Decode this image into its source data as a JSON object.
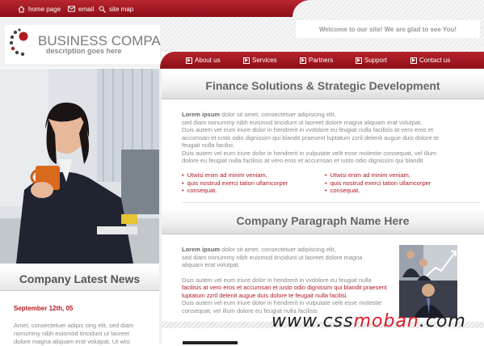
{
  "top_links": [
    {
      "label": "home page",
      "icon": "home-icon"
    },
    {
      "label": "email",
      "icon": "email-icon"
    },
    {
      "label": "site map",
      "icon": "sitemap-icon"
    }
  ],
  "logo": {
    "title": "BUSINESS COMPANY",
    "description": "description goes here"
  },
  "welcome": "Welcome to our site! We are glad to see You!",
  "nav": [
    "About us",
    "Services",
    "Partners",
    "Support",
    "Contact us"
  ],
  "section1": {
    "title": "Finance Solutions & Strategic Development",
    "lead_bold": "Lorem ipsum",
    "lead_rest": " dolor sit amet, consectetuer adipiscing elit,",
    "lines": [
      "sed diam nonummy nibh euismod tincidunt ut laoreet dolore magna aliquam erat volutpat.",
      "Duis autem vel eum iriure dolor in hendrerit in vvdolore eu feugiat nulla facilisis at vero eros et",
      "accumsan et iusto odio dignissim qui blandit praesent luptatum zzril delenit augue duis dolore te",
      "feugait nulla facilisi.",
      "Duis autem vel eum iriure dolor in hendrerit in vulputate velit esse molestie consequat, vel illum",
      "dolore eu feugiat nulla facilisis at vero eros et accumsan et iusto odio dignissim qui blandit"
    ],
    "bullets_left": [
      "Utwisi enim ad minim veniam,",
      "quis nostrud exerci tation ullamcorper",
      "consequat."
    ],
    "bullets_right": [
      "Utwisi enim ad minim veniam,",
      "quis nostrud exerci tation ullamcorper",
      "consequat."
    ]
  },
  "section2": {
    "title": "Company Paragraph Name Here",
    "lead_bold": "Lorem ipsum",
    "lead_rest": " dolor sit amet, consectetuer adipiscing elit,",
    "lines_a": [
      "sed diam nonummy nibh euismod tincidunt ut laoreet dolore magna",
      "aliquam erat volutpat."
    ],
    "line_b1": "Duis autem vel eum iriure dolor in hendrerit in vvdolore eu feugiat nulla",
    "red_lines": [
      "facilisis at vero eros et accumsan et iusto odio dignissim qui blandit praesent",
      "luptatum zzril delenit augue duis dolore te feugait nulla facilisi."
    ],
    "lines_c": [
      "Duis autem vel eum iriure dolor in hendrerit in vulputate velit esse molestie",
      "consequat, vel illum dolore eu feugiat nulla facilisis"
    ]
  },
  "news": {
    "title": "Company Latest News",
    "date": "September 12th, 05",
    "text": "Amet, consectetuer adipis cing elit, sed diam nonummy nibh euismod tincidunt ut laoreet dolore magna aliquam erat volutpat. Ut wisi"
  },
  "watermark": {
    "part1": "www.css",
    "part2": "moban",
    "part3": ".com"
  },
  "colors": {
    "accent": "#b01a22",
    "nav": "#9e1720"
  }
}
